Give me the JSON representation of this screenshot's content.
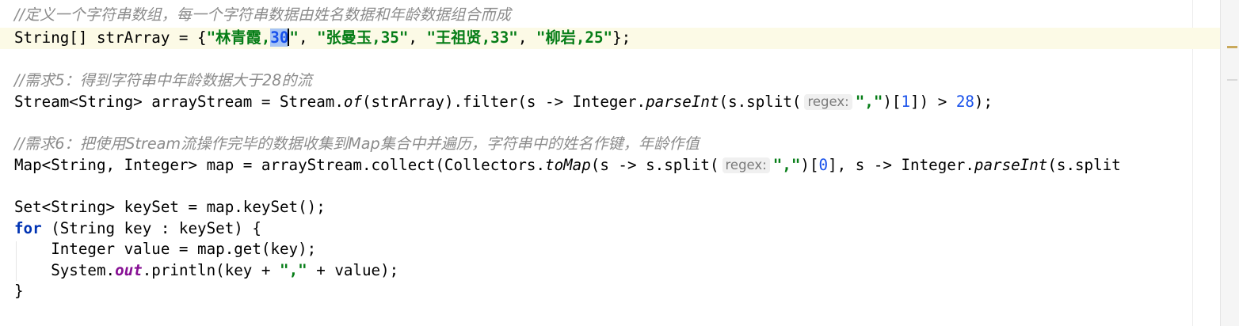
{
  "code": {
    "l1_comment": "//定义一个字符串数组，每一个字符串数据由姓名数据和年龄数据组合而成",
    "l2_type": "String[] strArray = {",
    "l2_s1a": "\"林青霞,",
    "l2_s1_sel": "30",
    "l2_s1b": "\"",
    "l2_sep1": ", ",
    "l2_s2": "\"张曼玉,35\"",
    "l2_sep2": ", ",
    "l2_s3": "\"王祖贤,33\"",
    "l2_sep3": ", ",
    "l2_s4": "\"柳岩,25\"",
    "l2_end": "};",
    "l4_comment_a": "//需求",
    "l4_comment_b": "5",
    "l4_comment_c": "：得到字符串中年龄数据大于",
    "l4_comment_d": "28",
    "l4_comment_e": "的流",
    "l5_a": "Stream<String> arrayStream = Stream.",
    "l5_of": "of",
    "l5_b": "(strArray).filter(s -> Integer.",
    "l5_parse": "parseInt",
    "l5_c": "(s.split(",
    "l5_hint": "regex:",
    "l5_str": "\",\"",
    "l5_d": ")[",
    "l5_n1": "1",
    "l5_e": "]) > ",
    "l5_n2": "28",
    "l5_f": ");",
    "l7_comment_a": "//需求",
    "l7_comment_b": "6",
    "l7_comment_c": "：把使用",
    "l7_comment_d": "Stream",
    "l7_comment_e": "流操作完毕的数据收集到",
    "l7_comment_f": "Map",
    "l7_comment_g": "集合中并遍历，字符串中的姓名作键，年龄作值",
    "l8_a": "Map<String, Integer> map = arrayStream.collect(Collectors.",
    "l8_tomap": "toMap",
    "l8_b": "(s -> s.split(",
    "l8_hint": "regex:",
    "l8_str": "\",\"",
    "l8_c": ")[",
    "l8_n1": "0",
    "l8_d": "], s -> Integer.",
    "l8_parse": "parseInt",
    "l8_e": "(s.split",
    "l10": "Set<String> keySet = map.keySet();",
    "l11_kw": "for",
    "l11_rest": " (String key : keySet) {",
    "l12": "    Integer value = map.get(key);",
    "l13_a": "    System.",
    "l13_out": "out",
    "l13_b": ".println(key + ",
    "l13_str": "\",\"",
    "l13_c": " + value);",
    "l14": "}"
  }
}
